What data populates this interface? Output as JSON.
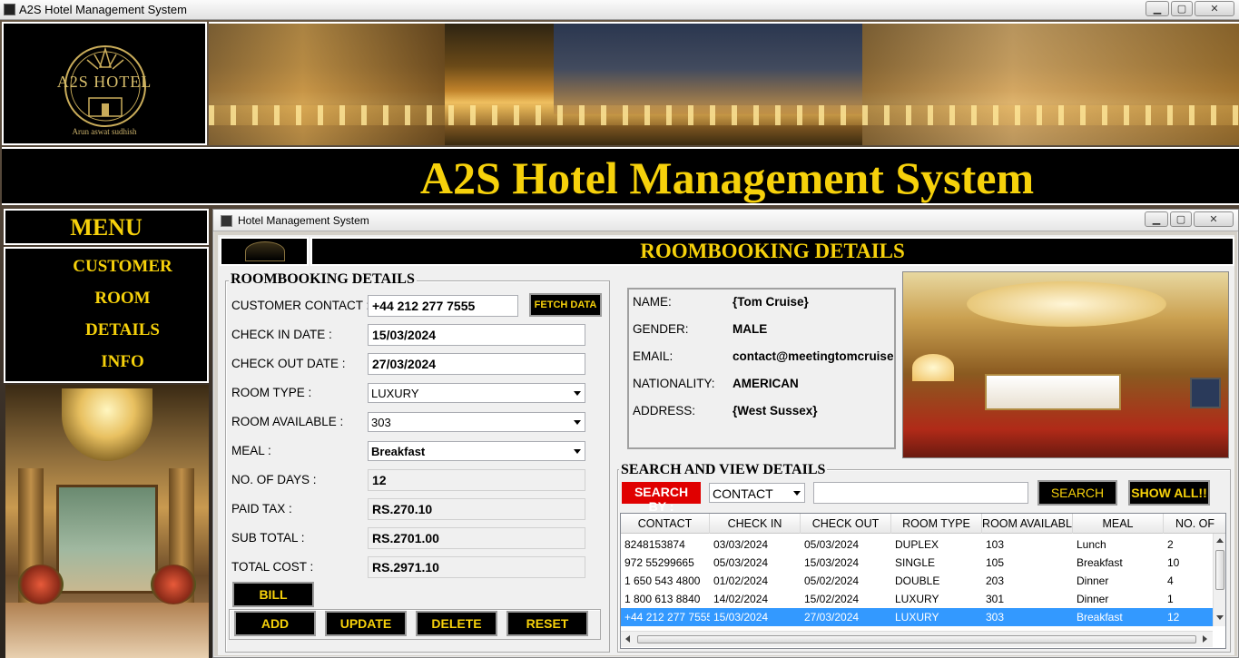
{
  "window": {
    "title": "A2S Hotel Management System",
    "controls": {
      "minimize": "▁",
      "maximize": "▢",
      "close": "✕"
    }
  },
  "logo": {
    "title": "A2S HOTEL",
    "subtitle": "Arun aswat sudhish"
  },
  "header": {
    "title": "A2S Hotel Management System"
  },
  "menu": {
    "heading": "MENU",
    "items": [
      {
        "label": "CUSTOMER"
      },
      {
        "label": "ROOM"
      },
      {
        "label": "DETAILS"
      },
      {
        "label": "INFO"
      }
    ]
  },
  "inner_window": {
    "title": "Hotel Management System",
    "controls": {
      "minimize": "▁",
      "maximize": "▢",
      "close": "✕"
    }
  },
  "roombooking": {
    "heading": "ROOMBOOKING DETAILS",
    "section_title": "ROOMBOOKING DETAILS",
    "fields": {
      "customer_contact": {
        "label": "CUSTOMER CONTACT :",
        "value": "+44 212 277 7555"
      },
      "check_in": {
        "label": "CHECK IN DATE :",
        "value": "15/03/2024"
      },
      "check_out": {
        "label": "CHECK OUT DATE :",
        "value": "27/03/2024"
      },
      "room_type": {
        "label": "ROOM TYPE :",
        "value": "LUXURY"
      },
      "room_available": {
        "label": "ROOM AVAILABLE :",
        "value": "303"
      },
      "meal": {
        "label": "MEAL :",
        "value": "Breakfast"
      },
      "no_of_days": {
        "label": "NO. OF DAYS :",
        "value": "12"
      },
      "paid_tax": {
        "label": "PAID TAX :",
        "value": "RS.270.10"
      },
      "sub_total": {
        "label": "SUB TOTAL :",
        "value": "RS.2701.00"
      },
      "total_cost": {
        "label": "TOTAL COST :",
        "value": "RS.2971.10"
      }
    },
    "buttons": {
      "fetch_data": "FETCH DATA",
      "bill": "BILL",
      "add": "ADD",
      "update": "UPDATE",
      "delete": "DELETE",
      "reset": "RESET"
    }
  },
  "customer_info": {
    "name": {
      "label": "NAME:",
      "value": "{Tom Cruise}"
    },
    "gender": {
      "label": "GENDER:",
      "value": "MALE"
    },
    "email": {
      "label": "EMAIL:",
      "value": "contact@meetingtomcruise.c"
    },
    "nationality": {
      "label": "NATIONALITY:",
      "value": "AMERICAN"
    },
    "address": {
      "label": "ADDRESS:",
      "value": "{West Sussex}"
    }
  },
  "search": {
    "section_title": "SEARCH AND VIEW DETAILS",
    "search_by_label": "SEARCH BY :",
    "search_by_value": "CONTACT",
    "query": "",
    "search_button": "SEARCH",
    "show_all_button": "SHOW ALL!!"
  },
  "table": {
    "columns": [
      "CONTACT",
      "CHECK IN",
      "CHECK OUT",
      "ROOM TYPE",
      "ROOM AVAILABL",
      "MEAL",
      "NO. OF"
    ],
    "rows": [
      [
        "8248153874",
        "03/03/2024",
        "05/03/2024",
        "DUPLEX",
        "103",
        "Lunch",
        "2"
      ],
      [
        "972 55299665",
        "05/03/2024",
        "15/03/2024",
        "SINGLE",
        "105",
        "Breakfast",
        "10"
      ],
      [
        "1 650 543 4800",
        "01/02/2024",
        "05/02/2024",
        "DOUBLE",
        "203",
        "Dinner",
        "4"
      ],
      [
        "1 800 613 8840",
        "14/02/2024",
        "15/02/2024",
        "LUXURY",
        "301",
        "Dinner",
        "1"
      ],
      [
        "+44 212 277 7555",
        "15/03/2024",
        "27/03/2024",
        "LUXURY",
        "303",
        "Breakfast",
        "12"
      ]
    ],
    "selected_row": 4
  },
  "colors": {
    "accent_gold": "#f6d10b",
    "panel_black": "#000000",
    "selection_blue": "#3399ff",
    "search_red": "#e00000"
  }
}
